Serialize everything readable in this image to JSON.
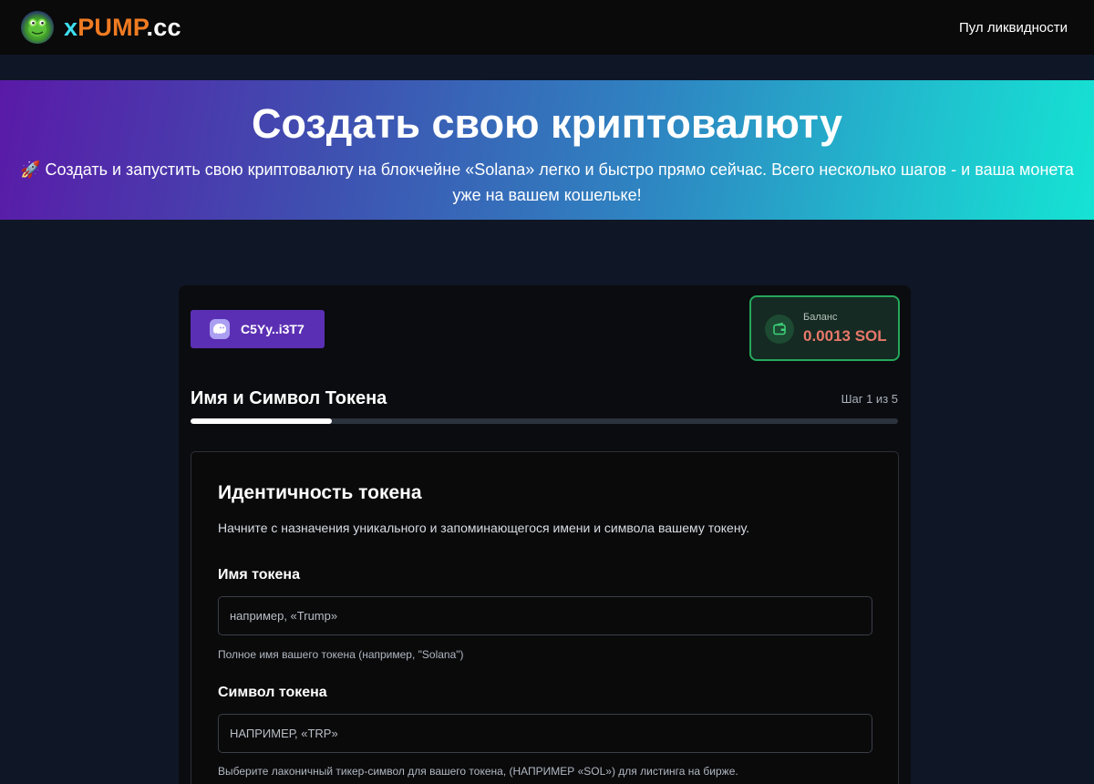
{
  "header": {
    "brand_x": "x",
    "brand_pump": "PUMP",
    "brand_cc": ".cc",
    "nav_liquidity": "Пул ликвидности"
  },
  "hero": {
    "title": "Создать свою криптовалюту",
    "subtitle": "🚀 Создать и запустить свою криптовалюту на блокчейне «Solana» легко и быстро прямо сейчас. Всего несколько шагов - и ваша монета уже на вашем кошельке!"
  },
  "wallet": {
    "address": "C5Yy..i3T7",
    "icon": "phantom-ghost-icon"
  },
  "balance": {
    "label": "Баланс",
    "value": "0.0013 SOL",
    "icon": "wallet-icon"
  },
  "step": {
    "title": "Имя и Символ Токена",
    "counter": "Шаг 1 из 5",
    "progress_fraction": 0.2
  },
  "form": {
    "section_title": "Идентичность токена",
    "section_desc": "Начните с назначения уникального и запоминающегося имени и символа вашему токену.",
    "name_label": "Имя токена",
    "name_placeholder": "например, «Trump»",
    "name_hint": "Полное имя вашего токена (например, \"Solana\")",
    "symbol_label": "Символ токена",
    "symbol_placeholder": "НАПРИМЕР, «TRP»",
    "symbol_hint": "Выберите лаконичный тикер-символ для вашего токена, (НАПРИМЕР «SOL») для листинга на бирже."
  },
  "colors": {
    "accent_purple": "#5b2fb3",
    "balance_green": "#26a85a",
    "balance_value": "#e8786a",
    "brand_cyan": "#3ee0f0",
    "brand_orange": "#f07b22"
  }
}
